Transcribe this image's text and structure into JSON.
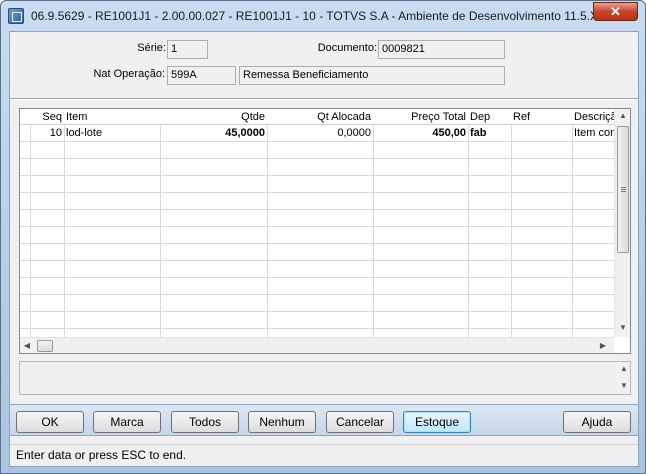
{
  "window": {
    "title": "06.9.5629 - RE1001J1 - 2.00.00.027 - RE1001J1 - 10 - TOTVS S.A - Ambiente de Desenvolvimento 11.5.X ...",
    "close_label": "✕"
  },
  "header": {
    "serie_label": "Série:",
    "serie_value": "1",
    "documento_label": "Documento:",
    "documento_value": "0009821",
    "nat_label": "Nat Operação:",
    "nat_code": "599A",
    "nat_desc": "Remessa Beneficiamento"
  },
  "grid": {
    "columns": [
      "",
      "Seq",
      "Item",
      "Qtde",
      "Qt Alocada",
      "Preço Total",
      "Dep",
      "Ref",
      "Descriçã"
    ],
    "rows": [
      {
        "seq": "10",
        "item": "lod-lote",
        "qtde": "45,0000",
        "qt_alocada": "0,0000",
        "preco_total": "450,00",
        "dep": "fab",
        "ref": "",
        "descricao": "Item con"
      }
    ]
  },
  "buttons": {
    "ok": "OK",
    "marca": "Marca",
    "todos": "Todos",
    "nenhum": "Nenhum",
    "cancelar": "Cancelar",
    "estoque": "Estoque",
    "ajuda": "Ajuda"
  },
  "status": {
    "message": "Enter data or press ESC to end."
  }
}
